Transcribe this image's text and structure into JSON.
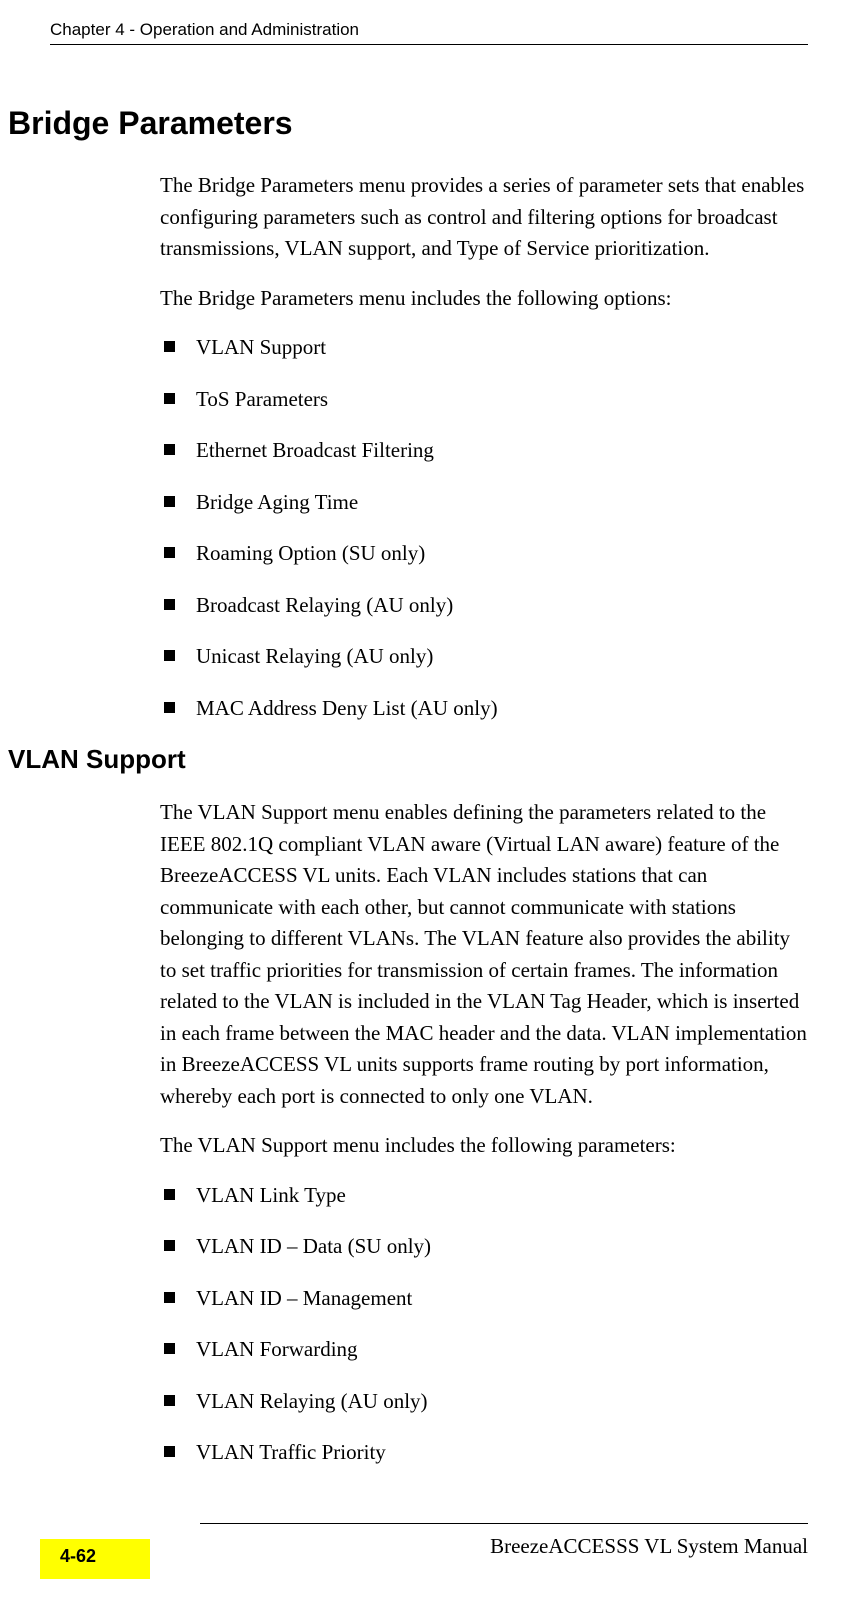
{
  "chapter_header": "Chapter 4 - Operation and Administration",
  "heading1": "Bridge Parameters",
  "para1": "The Bridge Parameters menu provides a series of parameter sets that enables configuring parameters such as control and filtering options for broadcast transmissions, VLAN support, and Type of Service prioritization.",
  "para2": "The Bridge Parameters menu includes the following options:",
  "list1": {
    "0": "VLAN Support",
    "1": "ToS Parameters",
    "2": "Ethernet Broadcast Filtering",
    "3": "Bridge Aging Time",
    "4": "Roaming Option (SU only)",
    "5": "Broadcast Relaying (AU only)",
    "6": "Unicast Relaying (AU only)",
    "7": "MAC Address Deny List (AU only)"
  },
  "heading2": "VLAN Support",
  "para3": "The VLAN Support menu enables defining the parameters related to the IEEE 802.1Q compliant VLAN aware (Virtual LAN aware) feature of the BreezeACCESS VL units. Each VLAN includes stations that can communicate with each other, but cannot communicate with stations belonging to different VLANs. The VLAN feature also provides the ability to set traffic priorities for transmission of certain frames. The information related to the VLAN is included in the VLAN Tag Header, which is inserted in each frame between the MAC header and the data. VLAN implementation in BreezeACCESS VL units supports frame routing by port information, whereby each port is connected to only one VLAN.",
  "para4": "The VLAN Support menu includes the following parameters:",
  "list2": {
    "0": "VLAN Link Type",
    "1": "VLAN ID – Data (SU only)",
    "2": "VLAN ID – Management",
    "3": "VLAN Forwarding",
    "4": "VLAN Relaying (AU only)",
    "5": "VLAN Traffic Priority"
  },
  "footer_text": "BreezeACCESSS VL System Manual",
  "page_number": "4-62"
}
